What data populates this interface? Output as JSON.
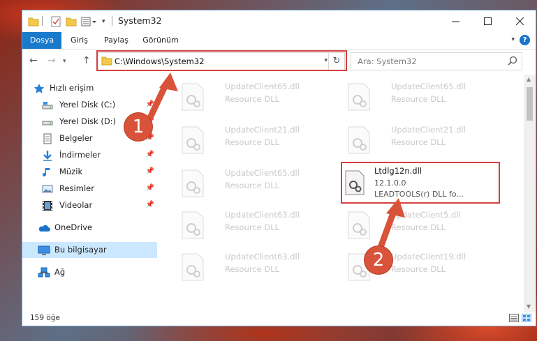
{
  "window": {
    "title": "System32",
    "ribbon_tabs": [
      "Dosya",
      "Giriş",
      "Paylaş",
      "Görünüm"
    ]
  },
  "address_bar": {
    "path": "C:\\Windows\\System32",
    "search_placeholder": "Ara: System32"
  },
  "sidebar": {
    "quick_access": "Hızlı erişim",
    "items": [
      {
        "label": "Yerel Disk (C:)",
        "pinned": true
      },
      {
        "label": "Yerel Disk (D:)",
        "pinned": true
      },
      {
        "label": "Belgeler",
        "pinned": true
      },
      {
        "label": "İndirmeler",
        "pinned": true
      },
      {
        "label": "Müzik",
        "pinned": true
      },
      {
        "label": "Resimler",
        "pinned": true
      },
      {
        "label": "Videolar",
        "pinned": true
      }
    ],
    "onedrive": "OneDrive",
    "this_pc": "Bu bilgisayar",
    "network": "Ağ"
  },
  "files": {
    "left": [
      {
        "name": "UpdateClient65.dll",
        "desc": "Resource DLL"
      },
      {
        "name": "UpdateClient21.dll",
        "desc": "Resource DLL"
      },
      {
        "name": "UpdateClient65.dll",
        "desc": "Resource DLL"
      },
      {
        "name": "UpdateClient63.dll",
        "desc": "Resource DLL"
      },
      {
        "name": "UpdateClient63.dll",
        "desc": "Resource DLL"
      }
    ],
    "right": [
      {
        "name": "UpdateClient65.dll",
        "desc": "Resource DLL"
      },
      {
        "name": "UpdateClient21.dll",
        "desc": "Resource DLL"
      },
      {
        "name": "UpdateClient5.dll",
        "desc": "Resource DLL"
      },
      {
        "name": "UpdateClient19.dll",
        "desc": "Resource DLL"
      }
    ],
    "highlighted": {
      "name": "Ltdlg12n.dll",
      "version": "12.1.0.0",
      "desc": "LEADTOOLS(r) DLL fo..."
    }
  },
  "status": {
    "item_count": "159 öğe"
  },
  "callouts": {
    "step1": "1",
    "step2": "2",
    "color": "#d9533a"
  },
  "colors": {
    "accent": "#1979ca",
    "highlight_box": "#d6403e",
    "selected_nav": "#cce8ff"
  }
}
